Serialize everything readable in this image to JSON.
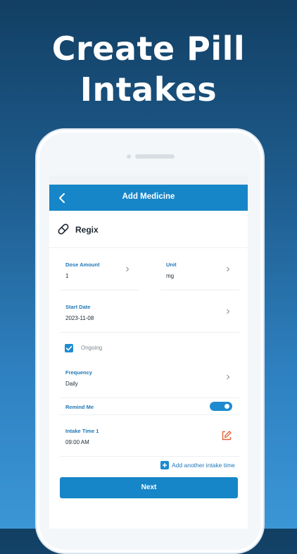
{
  "headline": "Create Pill Intakes",
  "header": {
    "title": "Add Medicine"
  },
  "medicine": {
    "name": "Regix"
  },
  "fields": {
    "dose_amount": {
      "label": "Dose Amount",
      "value": "1"
    },
    "unit": {
      "label": "Unit",
      "value": "mg"
    },
    "start_date": {
      "label": "Start Date",
      "value": "2023-11-08"
    },
    "frequency": {
      "label": "Frequency",
      "value": "Daily"
    },
    "intake_time": {
      "label": "Intake Time 1",
      "value": "09:00 AM"
    }
  },
  "ongoing": {
    "label": "Ongoing",
    "checked": true
  },
  "remind": {
    "label": "Remind Me",
    "on": true
  },
  "add_intake_label": "Add another intake time",
  "next_label": "Next",
  "colors": {
    "primary": "#1686c8",
    "label_blue": "#1e77b8",
    "edit_orange": "#e0653a"
  },
  "icons": [
    "back-arrow-icon",
    "pill-icon",
    "chevron-right-icon",
    "checkmark-icon",
    "edit-time-icon",
    "plus-icon"
  ]
}
